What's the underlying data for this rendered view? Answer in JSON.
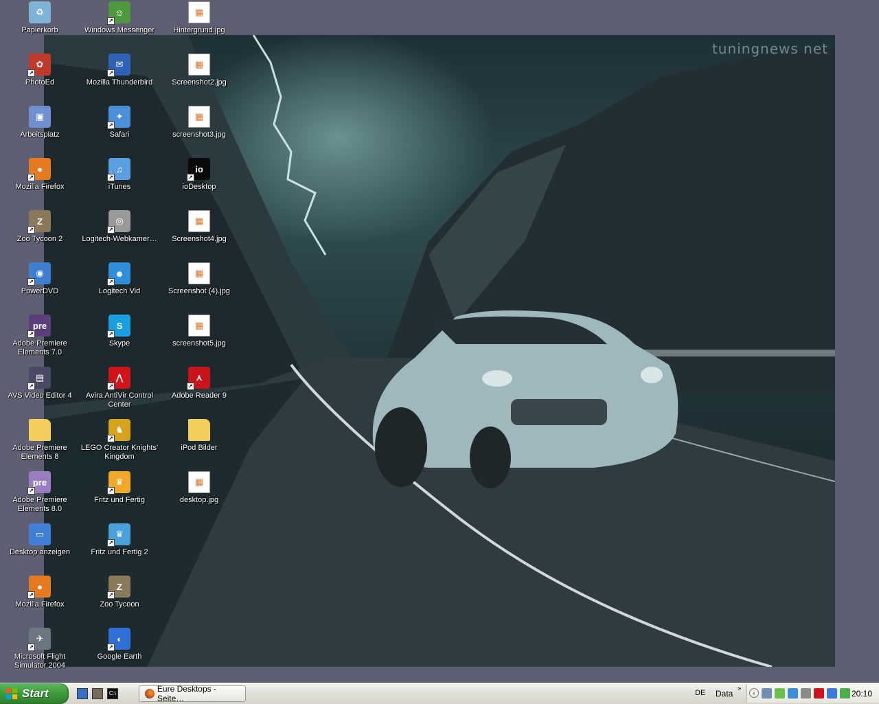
{
  "wallpaper": {
    "watermark": "tuningnews net"
  },
  "desktop": {
    "columns": [
      [
        {
          "id": "papierkorb",
          "label": "Papierkorb",
          "icon": "recycle-bin-icon",
          "color": "#7fb3d6",
          "text": "♻",
          "shortcut": false
        },
        {
          "id": "photoed",
          "label": "PhotoEd",
          "icon": "photoed-icon",
          "color": "#c0392b",
          "text": "✿",
          "shortcut": true
        },
        {
          "id": "arbeitsplatz",
          "label": "Arbeitsplatz",
          "icon": "my-computer-icon",
          "color": "#6f8fd0",
          "text": "▣",
          "shortcut": false
        },
        {
          "id": "firefox1",
          "label": "Mozilla Firefox",
          "icon": "firefox-icon",
          "color": "#e57b1e",
          "text": "●",
          "shortcut": true
        },
        {
          "id": "zootycoon2",
          "label": "Zoo Tycoon 2",
          "icon": "zoo-tycoon-icon",
          "color": "#8a7a5a",
          "text": "Z",
          "shortcut": true
        },
        {
          "id": "powerdvd",
          "label": "PowerDVD",
          "icon": "powerdvd-icon",
          "color": "#3d7ecf",
          "text": "◉",
          "shortcut": true
        },
        {
          "id": "premiere7",
          "label": "Adobe Premiere Elements 7.0",
          "icon": "adobe-premiere-icon",
          "color": "#5b3f7a",
          "text": "pre",
          "shortcut": true
        },
        {
          "id": "avs",
          "label": "AVS Video Editor 4",
          "icon": "film-strip-icon",
          "color": "#4a4a66",
          "text": "▤",
          "shortcut": true
        },
        {
          "id": "premiere8folder",
          "label": "Adobe Premiere Elements 8",
          "icon": "folder-icon",
          "color": "#f2cf5b",
          "text": "",
          "shortcut": false
        },
        {
          "id": "premiere8",
          "label": "Adobe Premiere Elements 8.0",
          "icon": "adobe-premiere-icon",
          "color": "#9a7cc0",
          "text": "pre",
          "shortcut": true
        },
        {
          "id": "desktopanzeigen",
          "label": "Desktop anzeigen",
          "icon": "show-desktop-icon",
          "color": "#3f7fd8",
          "text": "▭",
          "shortcut": false
        },
        {
          "id": "firefox2",
          "label": "Mozilla Firefox",
          "icon": "firefox-icon",
          "color": "#e57b1e",
          "text": "●",
          "shortcut": true
        },
        {
          "id": "flightsim",
          "label": "Microsoft Flight Simulator 2004",
          "icon": "airplane-icon",
          "color": "#6d7580",
          "text": "✈",
          "shortcut": true
        }
      ],
      [
        {
          "id": "messenger",
          "label": "Windows Messenger",
          "icon": "messenger-icon",
          "color": "#4f9a3e",
          "text": "☺",
          "shortcut": true
        },
        {
          "id": "thunderbird",
          "label": "Mozilla Thunderbird",
          "icon": "thunderbird-icon",
          "color": "#2f62b5",
          "text": "✉",
          "shortcut": true
        },
        {
          "id": "safari",
          "label": "Safari",
          "icon": "safari-compass-icon",
          "color": "#4a8fd8",
          "text": "✦",
          "shortcut": true
        },
        {
          "id": "itunes",
          "label": "iTunes",
          "icon": "itunes-icon",
          "color": "#5aa0e0",
          "text": "♫",
          "shortcut": true
        },
        {
          "id": "logitechwebcam",
          "label": "Logitech-Webkamer…",
          "icon": "webcam-icon",
          "color": "#9a9a9a",
          "text": "◎",
          "shortcut": true
        },
        {
          "id": "logitechvid",
          "label": "Logitech Vid",
          "icon": "logitech-vid-icon",
          "color": "#2f8fd8",
          "text": "☻",
          "shortcut": true
        },
        {
          "id": "skype",
          "label": "Skype",
          "icon": "skype-icon",
          "color": "#1aa0e0",
          "text": "S",
          "shortcut": true
        },
        {
          "id": "avira",
          "label": "Avira AntiVir Control Center",
          "icon": "avira-icon",
          "color": "#d0141a",
          "text": "⋀",
          "shortcut": true
        },
        {
          "id": "lego",
          "label": "LEGO Creator Knights' Kingdom",
          "icon": "lego-shield-icon",
          "color": "#d8a21a",
          "text": "♞",
          "shortcut": true
        },
        {
          "id": "fritz",
          "label": "Fritz und Fertig",
          "icon": "crown-icon",
          "color": "#f0a828",
          "text": "♛",
          "shortcut": true
        },
        {
          "id": "fritz2",
          "label": "Fritz und Fertig 2",
          "icon": "crown-icon",
          "color": "#4aa0d8",
          "text": "♛",
          "shortcut": true
        },
        {
          "id": "zootycoon",
          "label": "Zoo Tycoon",
          "icon": "zoo-tycoon-icon",
          "color": "#8a7a5a",
          "text": "Z",
          "shortcut": true
        },
        {
          "id": "googleearth",
          "label": "Google Earth",
          "icon": "google-earth-icon",
          "color": "#2f6fd8",
          "text": "◐",
          "shortcut": true
        }
      ],
      [
        {
          "id": "hintergrund",
          "label": "Hintergrund.jpg",
          "icon": "jpg-file-icon",
          "color": "#ffffff",
          "text": "▦",
          "shortcut": false
        },
        {
          "id": "screenshot2",
          "label": "Screenshot2.jpg",
          "icon": "jpg-file-icon",
          "color": "#ffffff",
          "text": "▦",
          "shortcut": false
        },
        {
          "id": "screenshot3",
          "label": "screenshot3.jpg",
          "icon": "jpg-file-icon",
          "color": "#ffffff",
          "text": "▦",
          "shortcut": false
        },
        {
          "id": "iodesktop",
          "label": "ioDesktop",
          "icon": "iodesktop-icon",
          "color": "#0a0a0a",
          "text": "io",
          "shortcut": true
        },
        {
          "id": "screenshot4",
          "label": "Screenshot4.jpg",
          "icon": "jpg-file-icon",
          "color": "#ffffff",
          "text": "▦",
          "shortcut": false
        },
        {
          "id": "screenshot4b",
          "label": "Screenshot (4).jpg",
          "icon": "jpg-file-icon",
          "color": "#ffffff",
          "text": "▦",
          "shortcut": false
        },
        {
          "id": "screenshot5",
          "label": "screenshot5.jpg",
          "icon": "jpg-file-icon",
          "color": "#ffffff",
          "text": "▦",
          "shortcut": false
        },
        {
          "id": "adobereader",
          "label": "Adobe Reader 9",
          "icon": "adobe-reader-icon",
          "color": "#c8141a",
          "text": "⋏",
          "shortcut": true
        },
        {
          "id": "ipodbilder",
          "label": "iPod Bilder",
          "icon": "folder-icon",
          "color": "#f2cf5b",
          "text": "",
          "shortcut": false
        },
        {
          "id": "desktopjpg",
          "label": "desktop.jpg",
          "icon": "jpg-file-icon",
          "color": "#ffffff",
          "text": "▦",
          "shortcut": false
        }
      ]
    ]
  },
  "taskbar": {
    "start_label": "Start",
    "quick_launch": [
      {
        "icon": "show-desktop-icon",
        "color": "#3a6fc8",
        "text": ""
      },
      {
        "icon": "media-icon",
        "color": "#7a6a5a",
        "text": ""
      },
      {
        "icon": "command-prompt-icon",
        "color": "#111111",
        "text": "C:\\"
      }
    ],
    "active_task": "Eure Desktops - Seite…",
    "language": "DE",
    "toolbar_label": "Data",
    "tray_icons": [
      {
        "icon": "network-icon",
        "color": "#6f8fb0"
      },
      {
        "icon": "messenger-tray-icon",
        "color": "#6ac04a"
      },
      {
        "icon": "logitech-tray-icon",
        "color": "#3a8fd8"
      },
      {
        "icon": "webcam-tray-icon",
        "color": "#8a8a8a"
      },
      {
        "icon": "avira-tray-icon",
        "color": "#d0141a"
      },
      {
        "icon": "user-tray-icon",
        "color": "#3a7ad8"
      },
      {
        "icon": "download-tray-icon",
        "color": "#4ab04a"
      }
    ],
    "clock": "20:10"
  }
}
